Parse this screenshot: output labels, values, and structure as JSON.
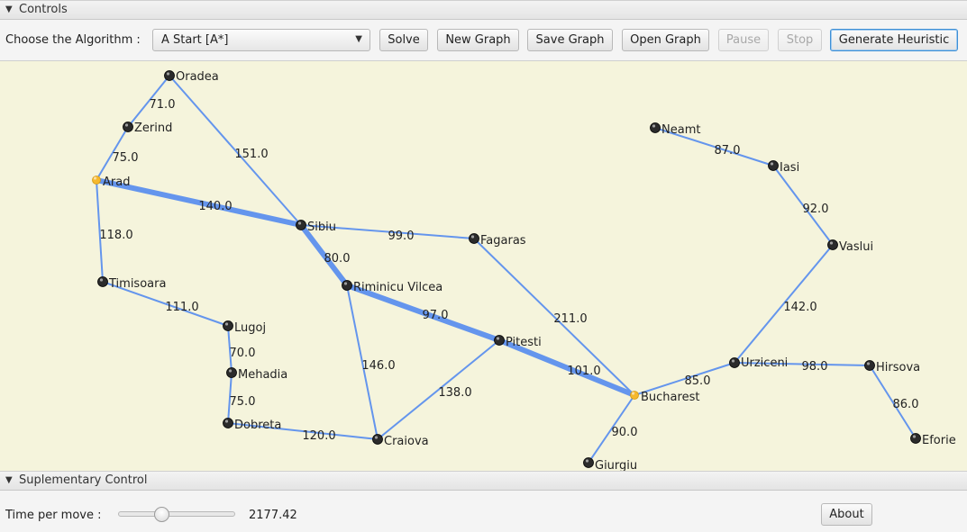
{
  "controls": {
    "header": "Controls",
    "algorithm_label": "Choose the Algorithm :",
    "algorithm_value": "A Start [A*]",
    "buttons": {
      "solve": "Solve",
      "new_graph": "New Graph",
      "save_graph": "Save Graph",
      "open_graph": "Open Graph",
      "pause": "Pause",
      "stop": "Stop",
      "generate_heuristic": "Generate Heuristic"
    }
  },
  "graph": {
    "colors": {
      "background": "#f5f4dc",
      "edge": "#6495ed",
      "node": "#2b2b2b",
      "highlight_node": "#f5b82e"
    },
    "nodes": [
      {
        "id": "oradea",
        "label": "Oradea"
      },
      {
        "id": "zerind",
        "label": "Zerind"
      },
      {
        "id": "arad",
        "label": "Arad",
        "highlight": true
      },
      {
        "id": "timisoara",
        "label": "Timisoara"
      },
      {
        "id": "lugoj",
        "label": "Lugoj"
      },
      {
        "id": "mehadia",
        "label": "Mehadia"
      },
      {
        "id": "dobreta",
        "label": "Dobreta"
      },
      {
        "id": "craiova",
        "label": "Craiova"
      },
      {
        "id": "sibiu",
        "label": "Sibiu"
      },
      {
        "id": "rimnicu",
        "label": "Riminicu Vilcea"
      },
      {
        "id": "fagaras",
        "label": "Fagaras"
      },
      {
        "id": "pitesti",
        "label": "Pitesti"
      },
      {
        "id": "bucharest",
        "label": "Bucharest",
        "highlight": true
      },
      {
        "id": "giurgiu",
        "label": "Giurgiu"
      },
      {
        "id": "urziceni",
        "label": "Urziceni"
      },
      {
        "id": "hirsova",
        "label": "Hirsova"
      },
      {
        "id": "eforie",
        "label": "Eforie"
      },
      {
        "id": "vaslui",
        "label": "Vaslui"
      },
      {
        "id": "iasi",
        "label": "Iasi"
      },
      {
        "id": "neamt",
        "label": "Neamt"
      }
    ],
    "edges": [
      {
        "from": "oradea",
        "to": "zerind",
        "weight": "71.0"
      },
      {
        "from": "zerind",
        "to": "arad",
        "weight": "75.0"
      },
      {
        "from": "oradea",
        "to": "sibiu",
        "weight": "151.0"
      },
      {
        "from": "arad",
        "to": "sibiu",
        "weight": "140.0",
        "path": true
      },
      {
        "from": "arad",
        "to": "timisoara",
        "weight": "118.0"
      },
      {
        "from": "timisoara",
        "to": "lugoj",
        "weight": "111.0"
      },
      {
        "from": "lugoj",
        "to": "mehadia",
        "weight": "70.0"
      },
      {
        "from": "mehadia",
        "to": "dobreta",
        "weight": "75.0"
      },
      {
        "from": "dobreta",
        "to": "craiova",
        "weight": "120.0"
      },
      {
        "from": "sibiu",
        "to": "fagaras",
        "weight": "99.0"
      },
      {
        "from": "sibiu",
        "to": "rimnicu",
        "weight": "80.0",
        "path": true
      },
      {
        "from": "rimnicu",
        "to": "craiova",
        "weight": "146.0"
      },
      {
        "from": "rimnicu",
        "to": "pitesti",
        "weight": "97.0",
        "path": true
      },
      {
        "from": "craiova",
        "to": "pitesti",
        "weight": "138.0"
      },
      {
        "from": "pitesti",
        "to": "bucharest",
        "weight": "101.0",
        "path": true
      },
      {
        "from": "fagaras",
        "to": "bucharest",
        "weight": "211.0"
      },
      {
        "from": "bucharest",
        "to": "giurgiu",
        "weight": "90.0"
      },
      {
        "from": "bucharest",
        "to": "urziceni",
        "weight": "85.0"
      },
      {
        "from": "urziceni",
        "to": "hirsova",
        "weight": "98.0"
      },
      {
        "from": "hirsova",
        "to": "eforie",
        "weight": "86.0"
      },
      {
        "from": "urziceni",
        "to": "vaslui",
        "weight": "142.0"
      },
      {
        "from": "vaslui",
        "to": "iasi",
        "weight": "92.0"
      },
      {
        "from": "iasi",
        "to": "neamt",
        "weight": "87.0"
      }
    ]
  },
  "supplementary": {
    "header": "Suplementary Control",
    "time_label": "Time per move :",
    "time_value": "2177.42",
    "about": "About"
  }
}
